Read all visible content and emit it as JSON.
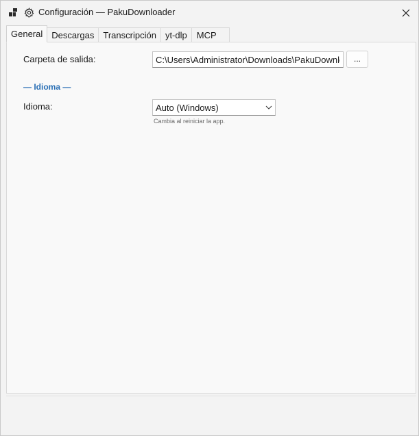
{
  "window": {
    "title": "Configuración — PakuDownloader"
  },
  "tabs": [
    {
      "label": "General",
      "active": true
    },
    {
      "label": "Descargas",
      "active": false
    },
    {
      "label": "Transcripción",
      "active": false
    },
    {
      "label": "yt-dlp",
      "active": false
    },
    {
      "label": "MCP",
      "active": false
    }
  ],
  "general": {
    "output_folder_label": "Carpeta de salida:",
    "output_folder_value": "C:\\Users\\Administrator\\Downloads\\PakuDownloader",
    "browse_label": "...",
    "language_section_title": "— Idioma —",
    "language_label": "Idioma:",
    "language_value": "Auto (Windows)",
    "language_hint": "Cambia al reiniciar la app."
  },
  "icons": {
    "app": "app-icon",
    "settings": "gear-icon",
    "close": "close-icon",
    "dropdown": "chevron-down-icon"
  },
  "colors": {
    "accent": "#2a6fb5",
    "panel": "#f9f9f9",
    "background": "#f3f3f3"
  }
}
